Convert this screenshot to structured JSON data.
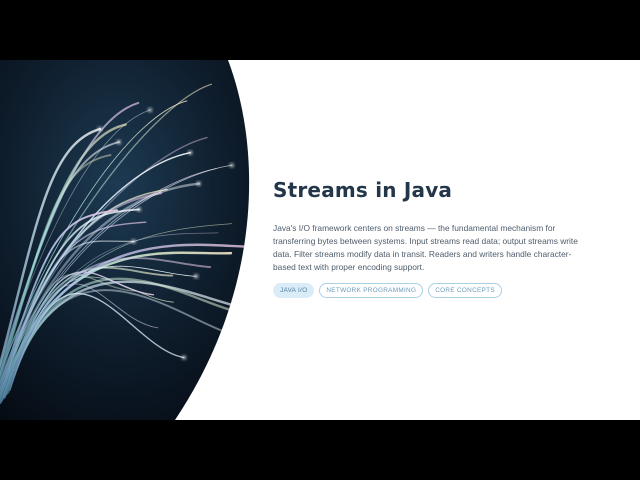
{
  "slide": {
    "title": "Streams in Java",
    "description": "Java's I/O framework centers on streams — the fundamental mechanism for transferring bytes between systems. Input streams read data; output streams write data. Filter streams modify data in transit. Readers and writers handle character-based text with proper encoding support.",
    "tags": [
      {
        "label": "JAVA I/O",
        "active": true
      },
      {
        "label": "NETWORK PROGRAMMING",
        "active": false
      },
      {
        "label": "CORE CONCEPTS",
        "active": false
      }
    ]
  },
  "colors": {
    "title": "#24364a",
    "text": "#4e5d6c",
    "tag_border": "#aacfe4",
    "tag_active_bg": "#d9ecf8",
    "image_bg": "#0b1522"
  },
  "image": {
    "subject": "fiber-optic-strands"
  }
}
